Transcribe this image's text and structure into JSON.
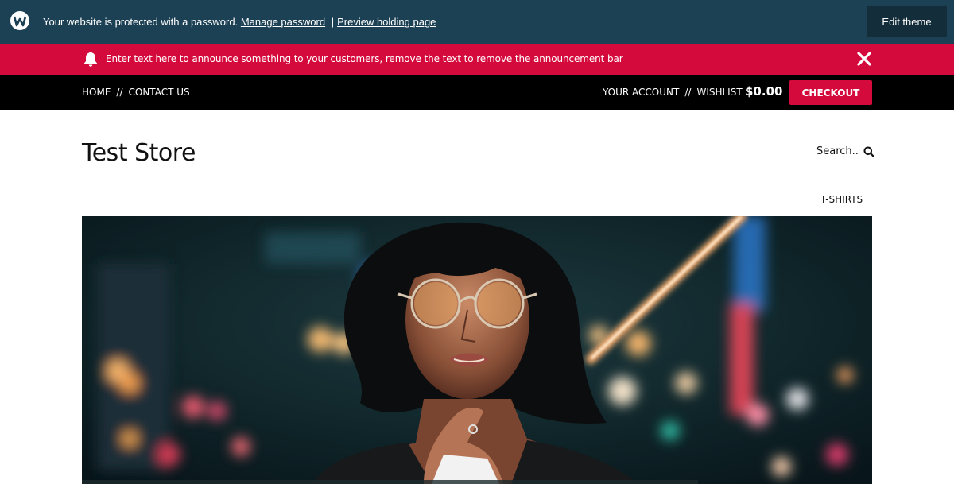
{
  "admin_bar": {
    "message": "Your website is protected with a password.",
    "manage_password": "Manage password",
    "separator": "|",
    "preview_holding_page": "Preview holding page",
    "edit_theme": "Edit theme",
    "logo_icon": "w-logo-icon"
  },
  "announcement": {
    "icon": "bell-icon",
    "text": "Enter text here to announce something to your customers, remove the text to remove the announcement bar",
    "close_icon": "close-icon"
  },
  "topnav": {
    "left": [
      "HOME",
      "CONTACT US"
    ],
    "separator": "//",
    "right": [
      "YOUR ACCOUNT",
      "WISHLIST"
    ],
    "cart_total": "$0.00",
    "checkout": "CHECKOUT"
  },
  "header": {
    "store_title": "Test Store",
    "search_label": "Search..",
    "search_icon": "search-icon",
    "menu_items": [
      "T-SHIRTS"
    ]
  },
  "colors": {
    "admin_bar": "#1c4155",
    "announcement": "#d50a3c",
    "nav": "#000000",
    "checkout": "#d50a3c"
  }
}
